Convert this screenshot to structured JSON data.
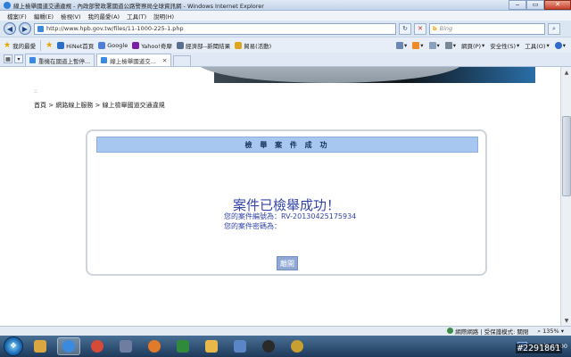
{
  "window": {
    "title": "線上檢舉國道交通違規 - 內政部警政署國道公路警察局全球資訊網 - Windows Internet Explorer",
    "min": "‒",
    "max": "▭",
    "close": "✕"
  },
  "menu": [
    "檔案(F)",
    "編輯(E)",
    "檢視(V)",
    "我的最愛(A)",
    "工具(T)",
    "說明(H)"
  ],
  "address": {
    "url": "http://www.hpb.gov.tw/files/11-1000-225-1.php",
    "search_placeholder": "Bing"
  },
  "favorites": {
    "label": "我的最愛",
    "items": [
      "HiNet首頁",
      "Google",
      "Yahoo!奇摩",
      "經濟部--新聞結果",
      "貿易(活動)"
    ]
  },
  "commands": [
    "網頁(P)",
    "安全性(S)",
    "工具(O)"
  ],
  "tabs": [
    {
      "label": "重機在國道上暫停..."
    },
    {
      "label": "線上檢舉國道交..."
    }
  ],
  "page": {
    "dots": "::",
    "breadcrumb": "首頁 > 網路線上服務 > 線上檢舉國道交通違規",
    "panel_title": "檢 舉 案 件 成 功",
    "success_msg": "案件已檢舉成功！",
    "case_number": "您的案件編號為：RV-20130425175934",
    "case_password": "您的案件密碼為：",
    "leave_button": "離開"
  },
  "status": {
    "zone": "網際網路 | 受保護模式: 關閉",
    "zoom": "135%"
  },
  "taskbar": {
    "lang": "A",
    "time": "下午 06:00"
  },
  "watermark": "#2291861",
  "colors": {
    "panel_header": "#a7c7f1",
    "message": "#3344aa",
    "button": "#8fa9d4"
  }
}
